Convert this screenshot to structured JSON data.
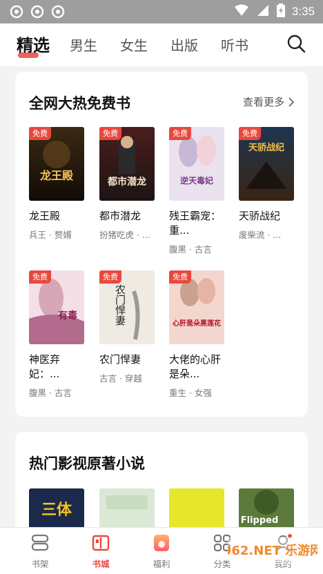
{
  "status_bar": {
    "time": "3:35",
    "icons": [
      "sync-icon",
      "sync-icon",
      "sync-icon",
      "wifi-icon",
      "signal-icon",
      "battery-icon"
    ]
  },
  "top_tabs": [
    {
      "label": "精选",
      "active": true
    },
    {
      "label": "男生"
    },
    {
      "label": "女生"
    },
    {
      "label": "出版"
    },
    {
      "label": "听书"
    }
  ],
  "section1": {
    "title": "全网大热免费书",
    "more": "查看更多",
    "badge": "免费",
    "books": [
      {
        "title": "龙王殿",
        "tags": "兵王 · 赘婿",
        "cover_text": "龙王殿"
      },
      {
        "title": "都市潜龙",
        "tags": "扮猪吃虎 · ...",
        "cover_text": "都市潜龙"
      },
      {
        "title": "残王霸宠：重...",
        "tags": "腹黑 · 古言",
        "cover_text": "逆天毒妃"
      },
      {
        "title": "天骄战纪",
        "tags": "废柴流 · ...",
        "cover_text": "天骄战纪"
      },
      {
        "title": "神医弃妃：...",
        "tags": "腹黑 · 古言",
        "cover_text": "有毒"
      },
      {
        "title": "农门悍妻",
        "tags": "古言 · 穿越",
        "cover_text": "农门悍妻"
      },
      {
        "title": "大佬的心肝是朵...",
        "tags": "重生 · 女强",
        "cover_text": "心肝是朵黑莲花"
      }
    ]
  },
  "section2": {
    "title": "热门影视原著小说",
    "covers": [
      "三体",
      "",
      "",
      "Flipped"
    ]
  },
  "bottom_nav": [
    {
      "label": "书架",
      "icon": "bookshelf-icon"
    },
    {
      "label": "书城",
      "icon": "bookstore-icon",
      "active": true
    },
    {
      "label": "福利",
      "icon": "gift-icon"
    },
    {
      "label": "分类",
      "icon": "category-icon"
    },
    {
      "label": "我的",
      "icon": "profile-icon"
    }
  ],
  "watermark": "962.NET 乐游网",
  "colors": {
    "accent": "#e8483e",
    "status_bar": "#9e9e9e",
    "background": "#f3f3f3"
  }
}
